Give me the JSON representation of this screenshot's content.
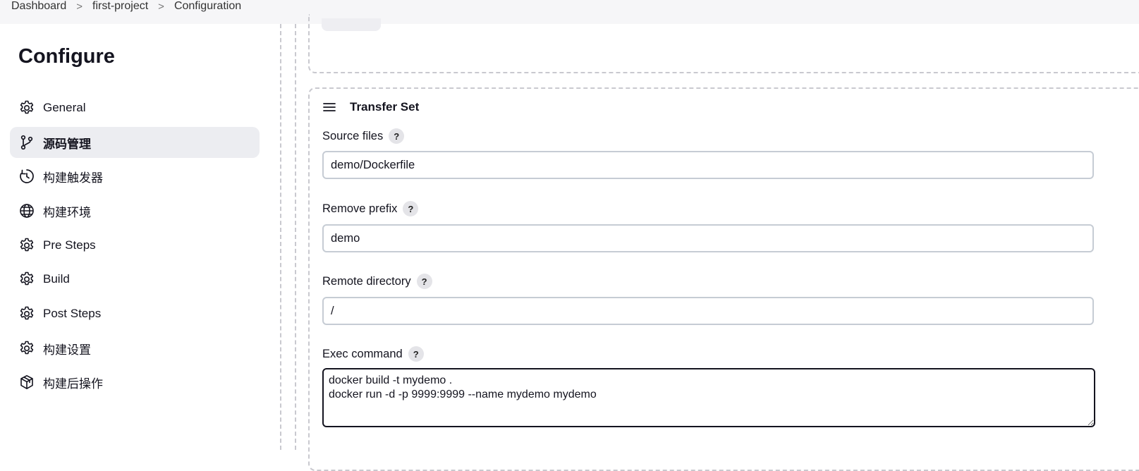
{
  "breadcrumb": {
    "items": [
      "Dashboard",
      "first-project",
      "Configuration"
    ],
    "separator": ">"
  },
  "sidebar": {
    "title": "Configure",
    "items": [
      {
        "label": "General",
        "icon": "gear-icon"
      },
      {
        "label": "源码管理",
        "icon": "source-branch-icon",
        "active": true
      },
      {
        "label": "构建触发器",
        "icon": "clock-trigger-icon"
      },
      {
        "label": "构建环境",
        "icon": "globe-icon"
      },
      {
        "label": "Pre Steps",
        "icon": "gear-icon"
      },
      {
        "label": "Build",
        "icon": "gear-icon"
      },
      {
        "label": "Post Steps",
        "icon": "gear-icon"
      },
      {
        "label": "构建设置",
        "icon": "gear-icon"
      },
      {
        "label": "构建后操作",
        "icon": "package-icon"
      }
    ]
  },
  "transfer_set": {
    "title": "Transfer Set",
    "help_label": "?",
    "source_files": {
      "label": "Source files",
      "value": "demo/Dockerfile"
    },
    "remove_prefix": {
      "label": "Remove prefix",
      "value": "demo"
    },
    "remote_directory": {
      "label": "Remote directory",
      "value": "/"
    },
    "exec_command": {
      "label": "Exec command",
      "value": "docker build -t mydemo .\ndocker run -d -p 9999:9999 --name mydemo mydemo"
    }
  },
  "colors": {
    "active_nav_bg": "#ecedf1",
    "dashed_border": "#c9c9cf",
    "input_border": "#c6ccd4",
    "focused_border": "#14141f"
  }
}
